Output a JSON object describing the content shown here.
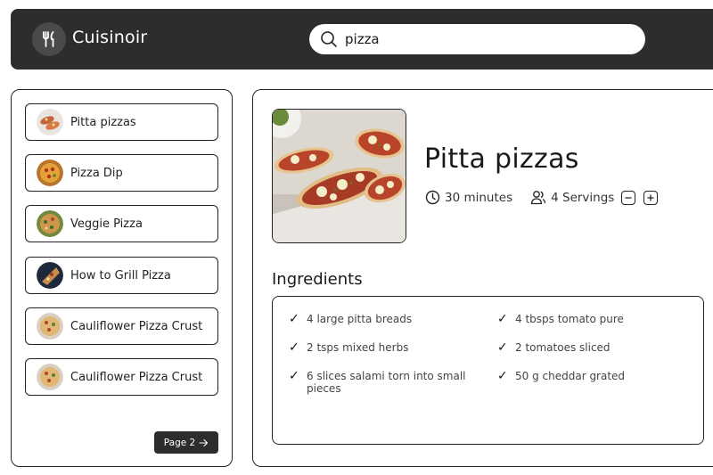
{
  "app": {
    "name": "Cuisinoir",
    "logo_icon": "utensils-icon"
  },
  "search": {
    "value": "pizza",
    "icon": "search-icon"
  },
  "sidebar": {
    "items": [
      {
        "label": "Pitta pizzas"
      },
      {
        "label": "Pizza Dip"
      },
      {
        "label": "Veggie Pizza"
      },
      {
        "label": "How to Grill Pizza"
      },
      {
        "label": "Cauliflower Pizza Crust"
      },
      {
        "label": "Cauliflower Pizza Crust"
      }
    ],
    "page_button": {
      "label": "Page 2",
      "icon": "arrow-right-icon"
    }
  },
  "recipe": {
    "title": "Pitta pizzas",
    "time": "30 minutes",
    "servings": "4 Servings",
    "ingredients_heading": "Ingredients",
    "ingredients": [
      "4 large pitta breads",
      "4 tbsps tomato pure",
      "2 tsps mixed herbs",
      "2 tomatoes sliced",
      "6 slices salami torn into small pieces",
      "50 g cheddar grated"
    ]
  },
  "colors": {
    "header_bg": "#2d2d2d",
    "border": "#222222",
    "page_button_bg": "#2d2d2d"
  }
}
